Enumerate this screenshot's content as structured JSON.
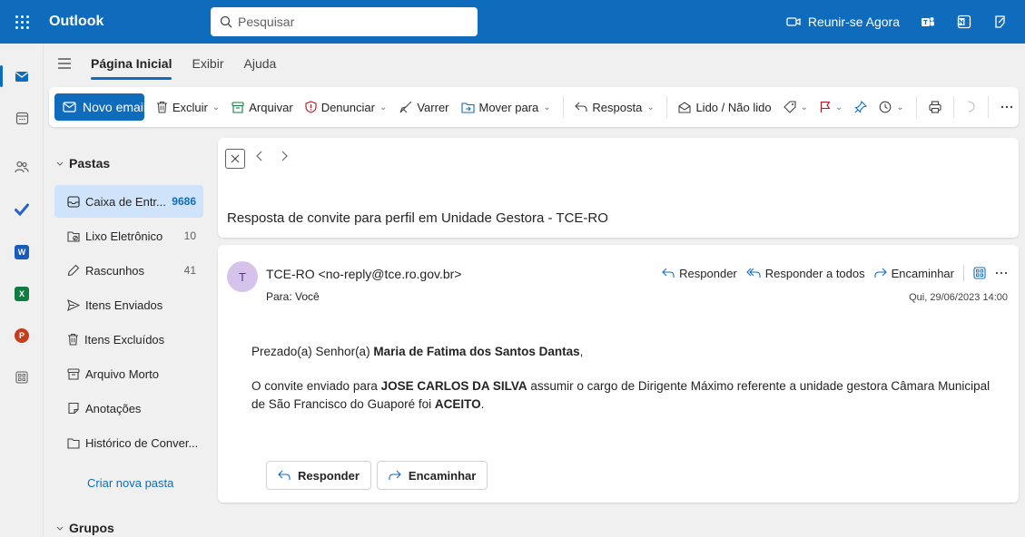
{
  "header": {
    "app_name": "Outlook",
    "search_placeholder": "Pesquisar",
    "meet_label": "Reunir-se Agora"
  },
  "rail": {
    "word_letter": "W",
    "excel_letter": "X",
    "powerpoint_letter": "P"
  },
  "ribbon": {
    "tabs": [
      {
        "label": "Página Inicial"
      },
      {
        "label": "Exibir"
      },
      {
        "label": "Ajuda"
      }
    ]
  },
  "toolbar": {
    "new_email": "Novo email",
    "delete": "Excluir",
    "archive": "Arquivar",
    "report": "Denunciar",
    "sweep": "Varrer",
    "move_to": "Mover para",
    "reply": "Resposta",
    "read_unread": "Lido / Não lido"
  },
  "folders": {
    "section_title": "Pastas",
    "items": [
      {
        "label": "Caixa de Entr...",
        "count": "9686"
      },
      {
        "label": "Lixo Eletrônico",
        "count": "10"
      },
      {
        "label": "Rascunhos",
        "count": "41"
      },
      {
        "label": "Itens Enviados",
        "count": ""
      },
      {
        "label": "Itens Excluídos",
        "count": ""
      },
      {
        "label": "Arquivo Morto",
        "count": ""
      },
      {
        "label": "Anotações",
        "count": ""
      },
      {
        "label": "Histórico de Conver...",
        "count": ""
      }
    ],
    "new_folder": "Criar nova pasta",
    "groups_title": "Grupos"
  },
  "message": {
    "subject": "Resposta de convite para perfil em Unidade Gestora - TCE-RO",
    "avatar_initial": "T",
    "sender": "TCE-RO <no-reply@tce.ro.gov.br>",
    "recipient": "Para:  Você",
    "date": "Qui, 29/06/2023 14:00",
    "actions": {
      "reply": "Responder",
      "reply_all": "Responder a todos",
      "forward": "Encaminhar"
    },
    "greeting_prefix": "Prezado(a) Senhor(a) ",
    "greeting_name": "Maria de Fatima dos Santos Dantas",
    "greeting_suffix": ",",
    "body_1": "O convite enviado para ",
    "body_name": "JOSE CARLOS DA SILVA",
    "body_2": " assumir o cargo de Dirigente Máximo referente a unidade gestora Câmara Municipal de São Francisco do Guaporé foi ",
    "body_status": "ACEITO",
    "body_3": ".",
    "reply_button": "Responder",
    "forward_button": "Encaminhar"
  },
  "colors": {
    "brand": "#0f6cbd",
    "selected_folder": "#cfe4fa",
    "avatar_bg": "#d6c3ec"
  }
}
